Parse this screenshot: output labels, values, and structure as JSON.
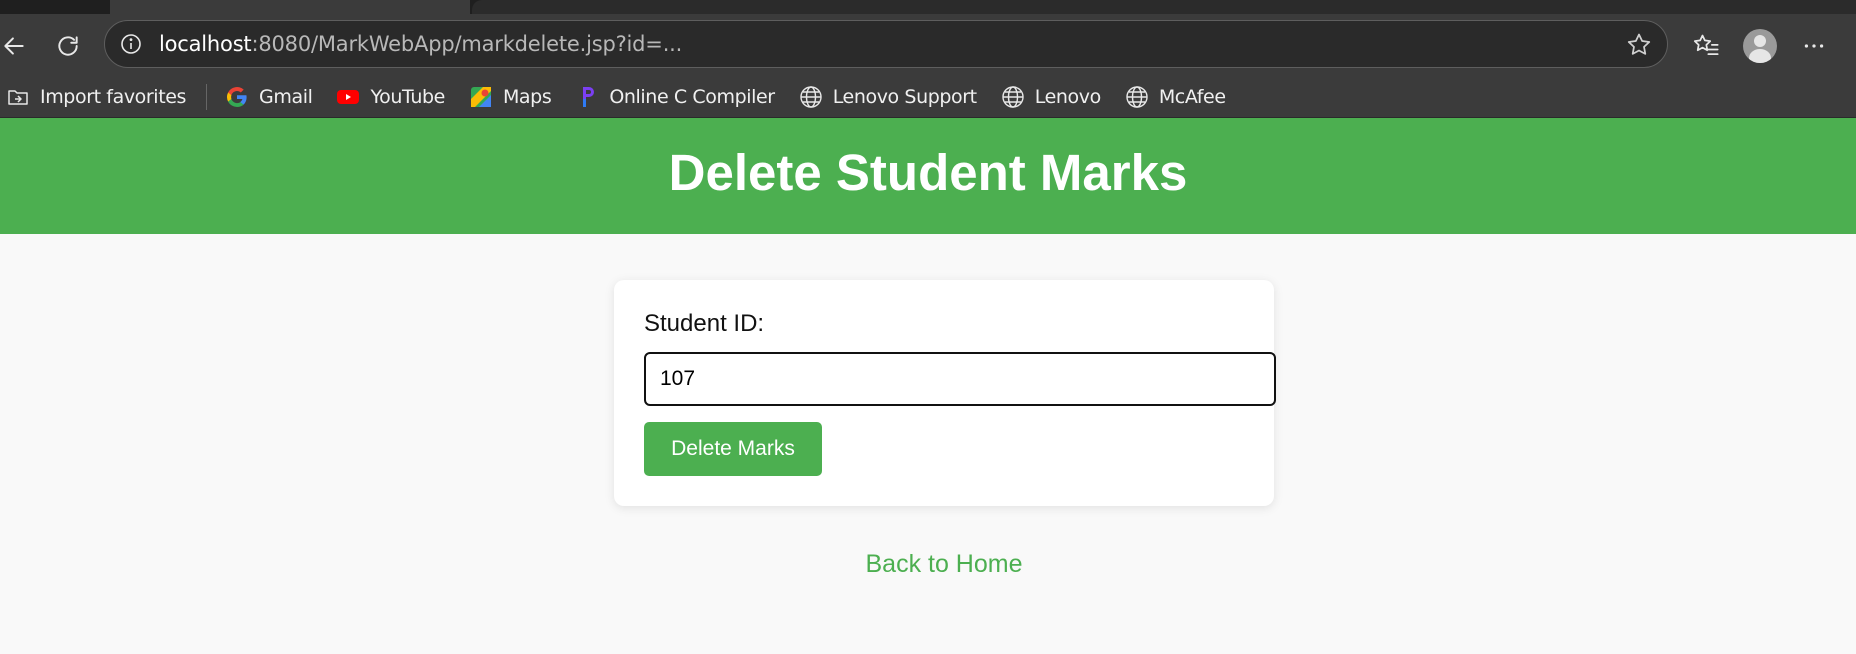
{
  "browser": {
    "url_host": "localhost",
    "url_rest": ":8080/MarkWebApp/markdelete.jsp?id=...",
    "bookmarks": [
      {
        "label": "Import favorites",
        "icon": "import-favorites-icon"
      },
      {
        "label": "Gmail",
        "icon": "google-icon"
      },
      {
        "label": "YouTube",
        "icon": "youtube-icon"
      },
      {
        "label": "Maps",
        "icon": "maps-icon"
      },
      {
        "label": "Online C Compiler",
        "icon": "compiler-icon"
      },
      {
        "label": "Lenovo Support",
        "icon": "globe-icon"
      },
      {
        "label": "Lenovo",
        "icon": "globe-icon"
      },
      {
        "label": "McAfee",
        "icon": "globe-icon"
      }
    ]
  },
  "page": {
    "title": "Delete Student Marks",
    "form": {
      "student_id_label": "Student ID:",
      "student_id_value": "107",
      "submit_label": "Delete Marks"
    },
    "back_link": "Back to Home"
  },
  "colors": {
    "accent": "#4caf50",
    "chrome": "#3b3b3b",
    "page_bg": "#f9f9f9"
  }
}
